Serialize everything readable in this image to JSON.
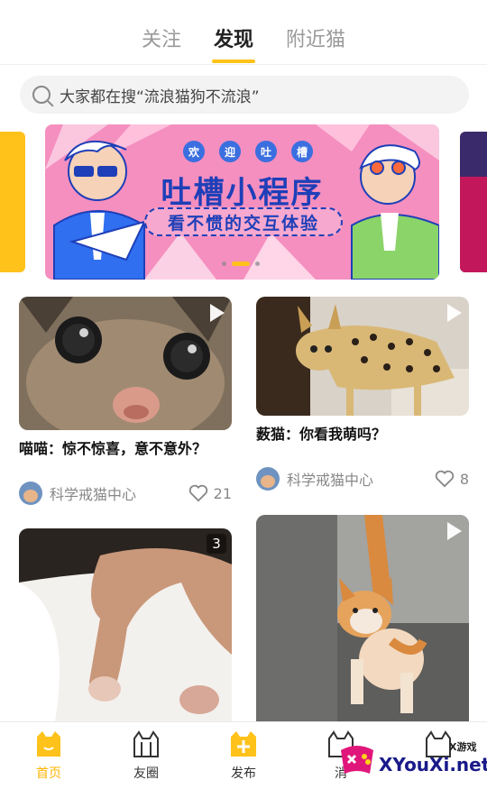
{
  "top_tabs": [
    {
      "label": "关注",
      "active": false
    },
    {
      "label": "发现",
      "active": true
    },
    {
      "label": "附近猫",
      "active": false
    }
  ],
  "search": {
    "text": "大家都在搜“流浪猫狗不流浪”"
  },
  "banner": {
    "top_chars": [
      "欢",
      "迎",
      "吐",
      "槽"
    ],
    "title": "吐槽小程序",
    "subtitle": "看不惯的交互体验",
    "page_count": 3,
    "active_index": 1
  },
  "feed": [
    {
      "title": "喵喵：惊不惊喜，意不意外？",
      "author": "科学戒猫中心",
      "likes": "21",
      "badge": "play"
    },
    {
      "title": "薮猫：你看我萌吗？",
      "author": "科学戒猫中心",
      "likes": "8",
      "badge": "play"
    },
    {
      "badge": "count",
      "count": "3"
    },
    {
      "badge": "play"
    }
  ],
  "bottom_nav": [
    {
      "label": "首页",
      "icon": "home-cat-icon",
      "active": true
    },
    {
      "label": "友圈",
      "icon": "friends-cat-icon",
      "active": false
    },
    {
      "label": "发布",
      "icon": "publish-plus-icon",
      "active": false
    },
    {
      "label": "消",
      "icon": "message-cat-icon",
      "active": false
    },
    {
      "label": "",
      "icon": "profile-cat-icon",
      "active": false
    }
  ],
  "watermark": {
    "brand": "XYouXi.net",
    "tag": "X游戏"
  },
  "colors": {
    "accent": "#ffc21a",
    "banner_bg": "#f58fbf",
    "banner_text": "#1e3fb8"
  }
}
